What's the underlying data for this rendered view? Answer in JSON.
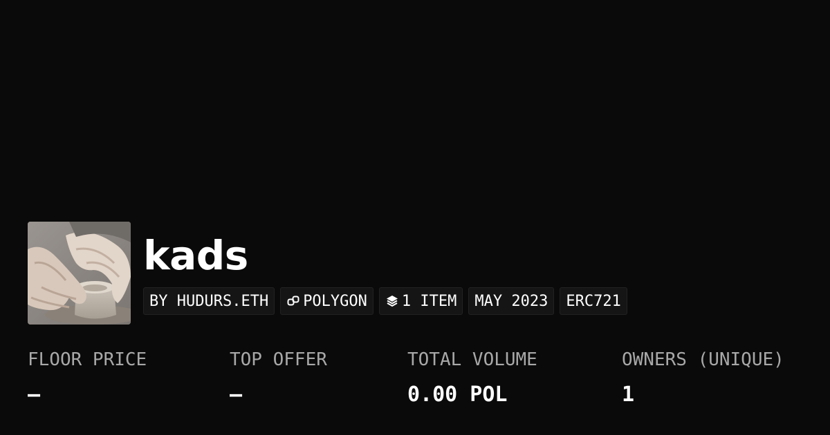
{
  "collection": {
    "name": "kads",
    "avatar_icon": "pottery-hands-image"
  },
  "tags": [
    {
      "label": "BY HUDURS.ETH",
      "icon": ""
    },
    {
      "label": "POLYGON",
      "icon": "polygon-link-icon"
    },
    {
      "label": "1 ITEM",
      "icon": "layers-icon"
    },
    {
      "label": "MAY 2023",
      "icon": ""
    },
    {
      "label": "ERC721",
      "icon": ""
    }
  ],
  "stats": [
    {
      "label": "FLOOR PRICE",
      "value": "–"
    },
    {
      "label": "TOP OFFER",
      "value": "–"
    },
    {
      "label": "TOTAL VOLUME",
      "value": "0.00 POL"
    },
    {
      "label": "OWNERS (UNIQUE)",
      "value": "1"
    }
  ],
  "colors": {
    "background": "#0a0a0a",
    "tag_background": "#151515",
    "label": "#a8a8a8",
    "text": "#ffffff"
  }
}
